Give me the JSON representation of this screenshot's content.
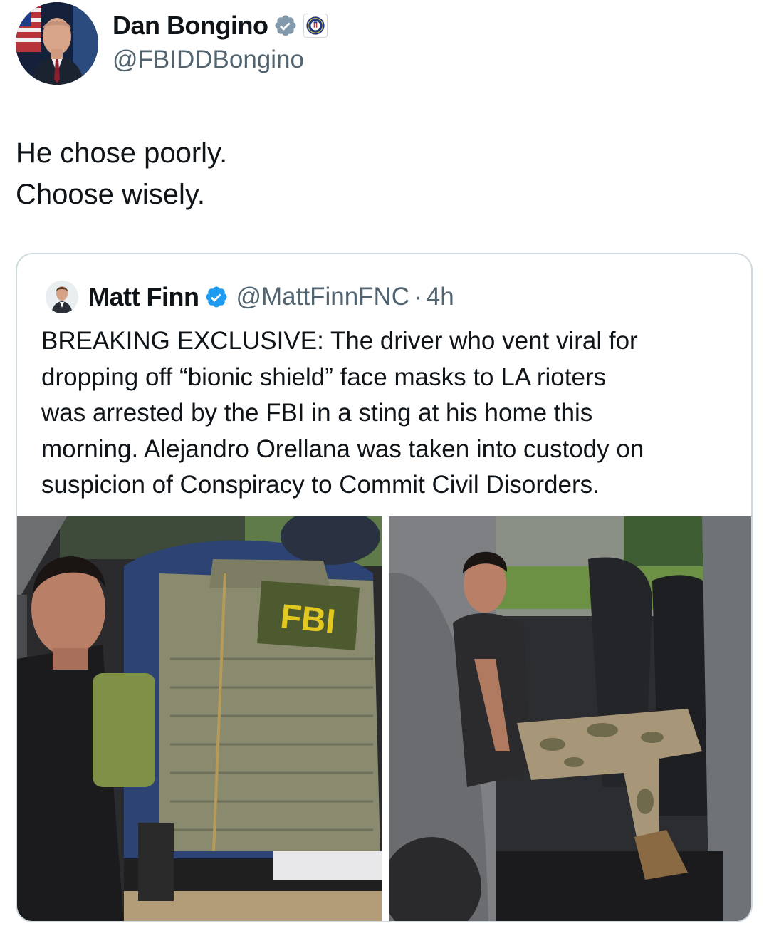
{
  "post": {
    "author": {
      "name": "Dan Bongino",
      "handle": "@FBIDDBongino",
      "verified_badge": "gray-check-icon",
      "affiliate_badge": "fbi-seal-icon",
      "avatar": "profile-photo"
    },
    "text_lines": [
      "He chose poorly.",
      "Choose wisely."
    ]
  },
  "quoted_post": {
    "author": {
      "name": "Matt Finn",
      "handle": "@MattFinnFNC",
      "separator": "·",
      "time": "4h",
      "verified_badge": "blue-check-icon",
      "avatar": "profile-photo"
    },
    "text_lines": [
      "BREAKING EXCLUSIVE:  The driver who vent viral for",
      "dropping off “bionic shield” face masks to LA rioters",
      "was arrested by the FBI in a sting at his home this",
      "morning.  Alejandro Orellana was taken into custody on",
      "suspicion of Conspiracy to Commit Civil Disorders."
    ],
    "media": {
      "left_photo": {
        "vest_text": "FBI"
      },
      "right_photo": {}
    }
  },
  "colors": {
    "text_primary": "#0f1419",
    "text_secondary": "#536471",
    "border": "#cfd9de",
    "verified_blue": "#1d9bf0",
    "verified_gray": "#829aab",
    "fbi_yellow": "#e3c820"
  }
}
